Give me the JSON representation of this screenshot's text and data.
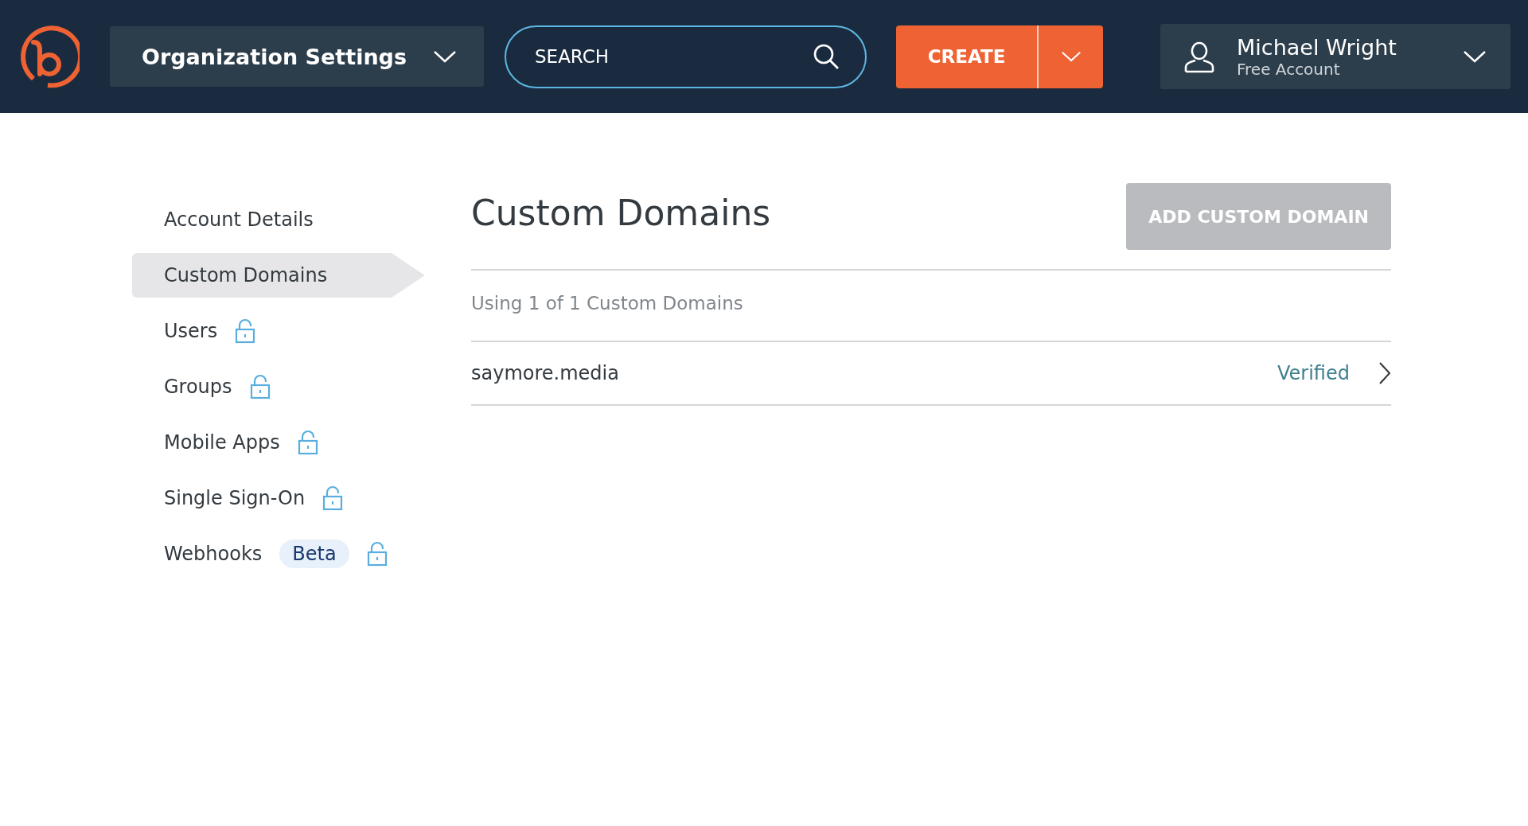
{
  "header": {
    "context_menu": {
      "label": "Organization Settings"
    },
    "search": {
      "placeholder": "SEARCH"
    },
    "create_button": {
      "label": "CREATE"
    },
    "user": {
      "name": "Michael Wright",
      "plan": "Free Account"
    }
  },
  "sidebar": {
    "items": [
      {
        "label": "Account Details",
        "selected": false,
        "locked": false
      },
      {
        "label": "Custom Domains",
        "selected": true,
        "locked": false
      },
      {
        "label": "Users",
        "selected": false,
        "locked": true
      },
      {
        "label": "Groups",
        "selected": false,
        "locked": true
      },
      {
        "label": "Mobile Apps",
        "selected": false,
        "locked": true
      },
      {
        "label": "Single Sign-On",
        "selected": false,
        "locked": true
      },
      {
        "label": "Webhooks",
        "badge": "Beta",
        "selected": false,
        "locked": true
      }
    ]
  },
  "main": {
    "title": "Custom Domains",
    "add_button": {
      "label": "ADD CUSTOM DOMAIN",
      "disabled": true
    },
    "usage": "Using 1 of 1 Custom Domains",
    "domains": [
      {
        "name": "saymore.media",
        "status": "Verified"
      }
    ]
  }
}
